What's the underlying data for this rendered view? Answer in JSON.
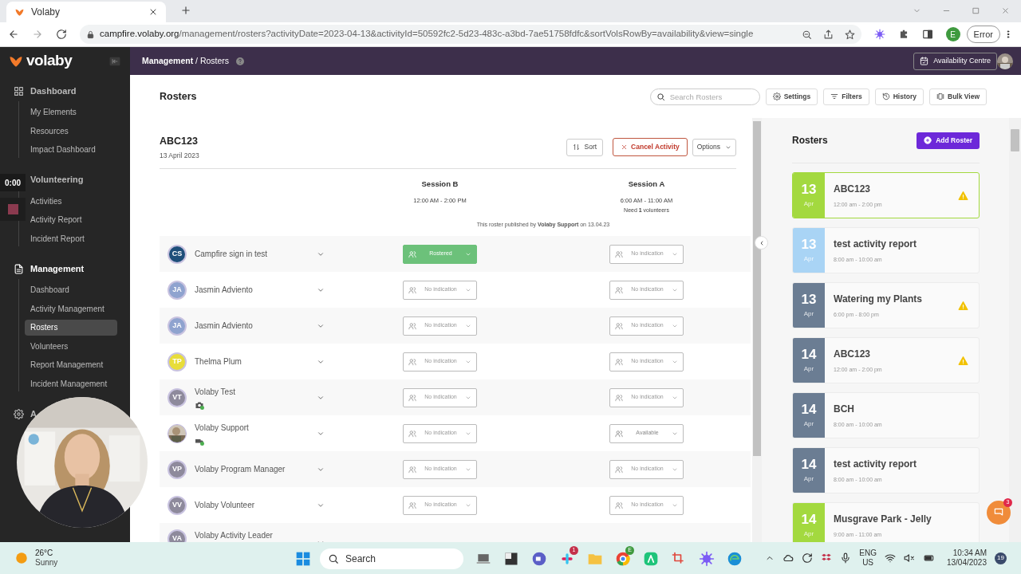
{
  "browser": {
    "tab_title": "Volaby",
    "url_host": "campfire.volaby.org",
    "url_path": "/management/rosters?activityDate=2023-04-13&activityId=50592fc2-5d23-483c-a3bd-7ae51758fdfc&sortVolsRowBy=availability&view=single",
    "profile": "E",
    "error_button": "Error"
  },
  "app_header": {
    "logo": "volaby",
    "breadcrumb_parent": "Management",
    "breadcrumb_separator": "/",
    "breadcrumb_current": "Rosters",
    "availability_button": "Availability Centre"
  },
  "sidebar": {
    "sections": [
      {
        "label": "Dashboard",
        "active": false,
        "items": [
          {
            "label": "My Elements",
            "selected": false
          },
          {
            "label": "Resources",
            "selected": false
          },
          {
            "label": "Impact Dashboard",
            "selected": false
          }
        ]
      },
      {
        "label": "Volunteering",
        "active": false,
        "items": [
          {
            "label": "Activities",
            "selected": false
          },
          {
            "label": "Activity Report",
            "selected": false
          },
          {
            "label": "Incident Report",
            "selected": false
          }
        ]
      },
      {
        "label": "Management",
        "active": true,
        "items": [
          {
            "label": "Dashboard",
            "selected": false
          },
          {
            "label": "Activity Management",
            "selected": false
          },
          {
            "label": "Rosters",
            "selected": true
          },
          {
            "label": "Volunteers",
            "selected": false
          },
          {
            "label": "Report Management",
            "selected": false
          },
          {
            "label": "Incident Management",
            "selected": false
          }
        ]
      },
      {
        "label": "A",
        "active": false
      }
    ]
  },
  "recording": {
    "timer": "0:00"
  },
  "page": {
    "title": "Rosters",
    "search_placeholder": "Search Rosters",
    "toolbar": [
      "Settings",
      "Filters",
      "History",
      "Bulk View"
    ]
  },
  "roster": {
    "title": "ABC123",
    "date": "13 April 2023",
    "sort_button": "Sort",
    "cancel_button": "Cancel Activity",
    "options_button": "Options",
    "sessions": [
      {
        "name": "Session B",
        "time": "12:00 AM - 2:00 PM"
      },
      {
        "name": "Session A",
        "time": "6:00 AM - 11:00 AM",
        "need": "Need **1** volunteers"
      }
    ],
    "published": "This roster published by **Volaby Support** on 13.04.23",
    "volunteers": [
      {
        "initials": "CS",
        "name": "Campfire sign in test",
        "color": "#1e4f7a",
        "session_b": {
          "label": "Rostered",
          "kind": "rostered"
        },
        "session_a": {
          "label": "No indication",
          "kind": "none"
        }
      },
      {
        "initials": "JA",
        "name": "Jasmin Adviento",
        "color": "#8fa3cf",
        "session_b": {
          "label": "No indication",
          "kind": "none"
        },
        "session_a": {
          "label": "No indication",
          "kind": "none"
        }
      },
      {
        "initials": "JA",
        "name": "Jasmin Adviento",
        "color": "#8fa3cf",
        "session_b": {
          "label": "No indication",
          "kind": "none"
        },
        "session_a": {
          "label": "No indication",
          "kind": "none"
        }
      },
      {
        "initials": "TP",
        "name": "Thelma Plum",
        "color": "#e8dd3a",
        "session_b": {
          "label": "No indication",
          "kind": "none"
        },
        "session_a": {
          "label": "No indication",
          "kind": "none"
        }
      },
      {
        "initials": "VT",
        "name": "Volaby Test",
        "color": "#8e8a9c",
        "credential": {
          "kind": "camera"
        },
        "session_b": {
          "label": "No indication",
          "kind": "none"
        },
        "session_a": {
          "label": "No indication",
          "kind": "none"
        }
      },
      {
        "name": "Volaby Support",
        "credential": {
          "kind": "vehicle"
        },
        "session_b": {
          "label": "No indication",
          "kind": "none"
        },
        "session_a": {
          "label": "Available",
          "kind": "available"
        }
      },
      {
        "initials": "VP",
        "name": "Volaby Program Manager",
        "color": "#8e8a9c",
        "session_b": {
          "label": "No indication",
          "kind": "none"
        },
        "session_a": {
          "label": "No indication",
          "kind": "none"
        }
      },
      {
        "initials": "VV",
        "name": "Volaby Volunteer",
        "color": "#8e8a9c",
        "session_b": {
          "label": "No indication",
          "kind": "none"
        },
        "session_a": {
          "label": "No indication",
          "kind": "none"
        }
      },
      {
        "initials": "VA",
        "name": "Volaby Activity Leader",
        "color": "#8e8a9c"
      }
    ]
  },
  "rosters_panel": {
    "title": "Rosters",
    "add_button": "Add Roster",
    "items": [
      {
        "day": "13",
        "month": "Apr",
        "title": "ABC123",
        "time": "12:00 am - 2:00 pm",
        "color": "#a3d93f",
        "warning": true,
        "selected": true
      },
      {
        "day": "13",
        "month": "Apr",
        "title": "test activity report",
        "time": "8:00 am - 10:00 am",
        "color": "#a9d4f5",
        "warning": false,
        "selected": false
      },
      {
        "day": "13",
        "month": "Apr",
        "title": "Watering my Plants",
        "time": "6:00 pm - 8:00 pm",
        "color": "#6b7d93",
        "warning": true,
        "selected": false
      },
      {
        "day": "14",
        "month": "Apr",
        "title": "ABC123",
        "time": "12:00 am - 2:00 pm",
        "color": "#6b7d93",
        "warning": true,
        "selected": false
      },
      {
        "day": "14",
        "month": "Apr",
        "title": "BCH",
        "time": "8:00 am - 10:00 am",
        "color": "#6b7d93",
        "warning": false,
        "selected": false
      },
      {
        "day": "14",
        "month": "Apr",
        "title": "test activity report",
        "time": "8:00 am - 10:00 am",
        "color": "#6b7d93",
        "warning": false,
        "selected": false
      },
      {
        "day": "14",
        "month": "Apr",
        "title": "Musgrave Park - Jelly",
        "time": "9:00 am - 11:00 am",
        "color": "#a3d93f",
        "warning": false,
        "selected": false
      }
    ],
    "chat_badge": "3"
  },
  "taskbar": {
    "temperature": "26°C",
    "weather": "Sunny",
    "search": "Search",
    "slack_badge": "1",
    "chrome_badge": "E",
    "language": "ENG",
    "region": "US",
    "time": "10:34 AM",
    "date": "13/04/2023",
    "notifications": "19"
  }
}
